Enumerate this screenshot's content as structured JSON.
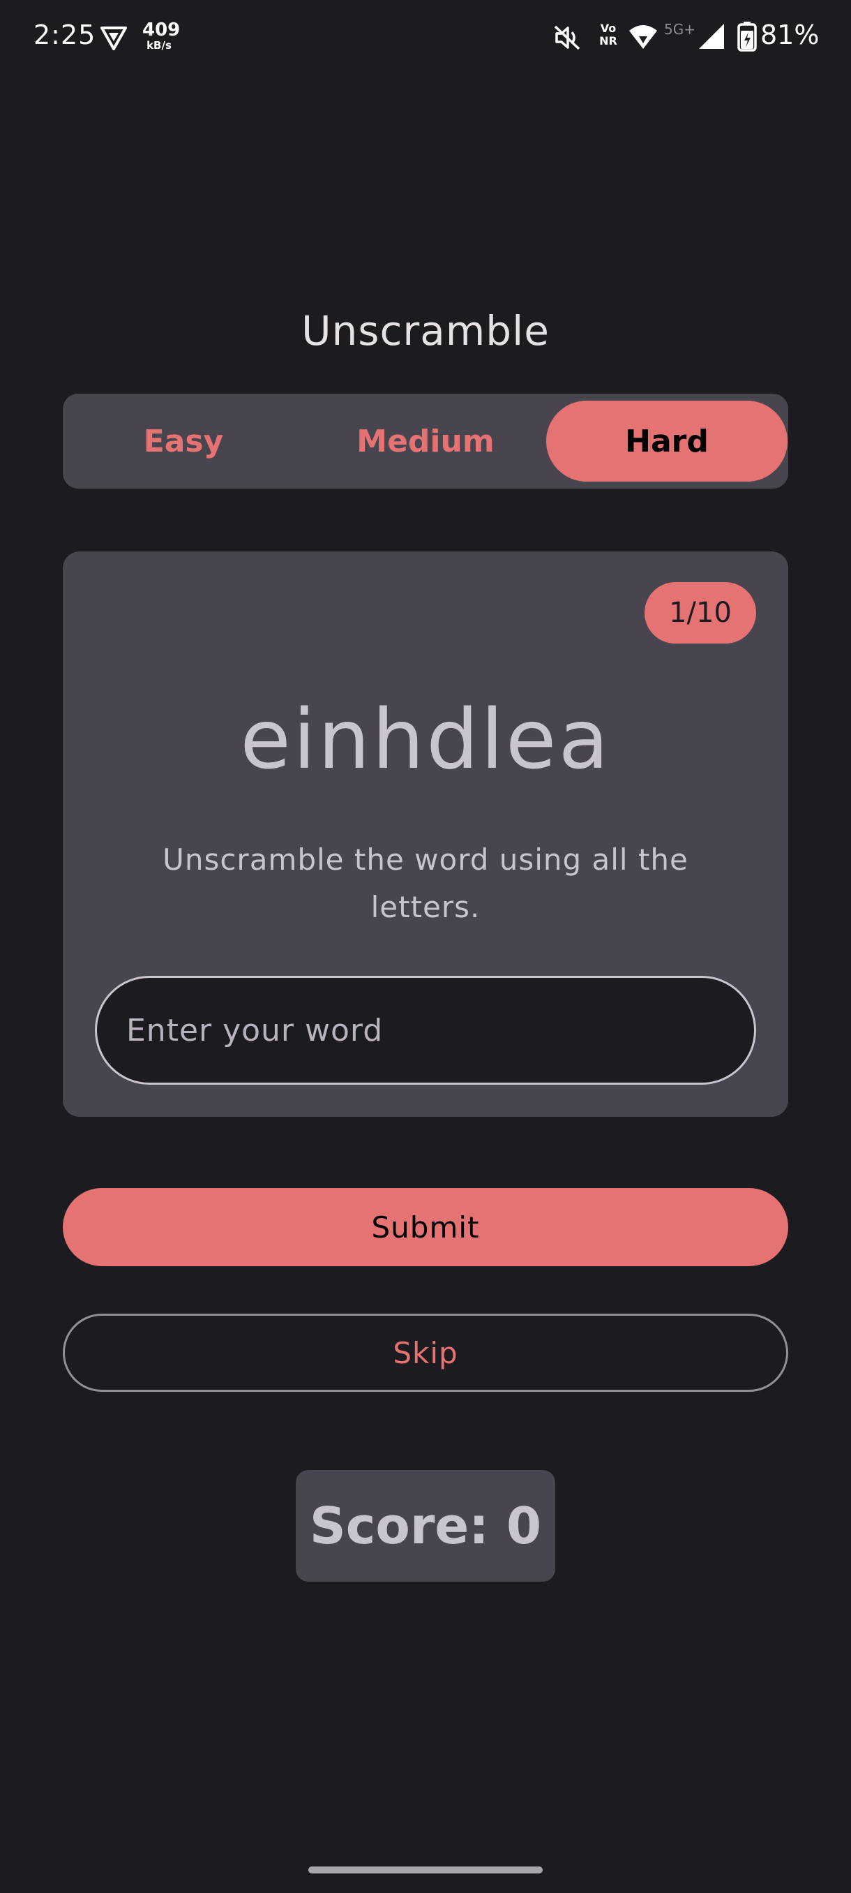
{
  "status_bar": {
    "time": "2:25",
    "speed_value": "409",
    "speed_unit": "kB/s",
    "volte_top": "Vo",
    "volte_bottom": "NR",
    "network": "5G+",
    "battery_percent": "81%",
    "icons": [
      "vpn-icon",
      "mute-icon",
      "volte-icon",
      "wifi-icon",
      "signal-icon",
      "battery-icon"
    ]
  },
  "app": {
    "title": "Unscramble"
  },
  "difficulty": {
    "options": [
      "Easy",
      "Medium",
      "Hard"
    ],
    "selected": "Hard"
  },
  "game": {
    "progress": "1/10",
    "scrambled_word": "einhdlea",
    "instruction": "Unscramble the word using all the letters.",
    "input_placeholder": "Enter your word",
    "input_value": ""
  },
  "actions": {
    "submit_label": "Submit",
    "skip_label": "Skip"
  },
  "score": {
    "text": "Score: 0"
  },
  "colors": {
    "background": "#1c1b1f",
    "surface": "#49454f",
    "accent": "#e57373",
    "on_surface": "#cac4d0"
  }
}
